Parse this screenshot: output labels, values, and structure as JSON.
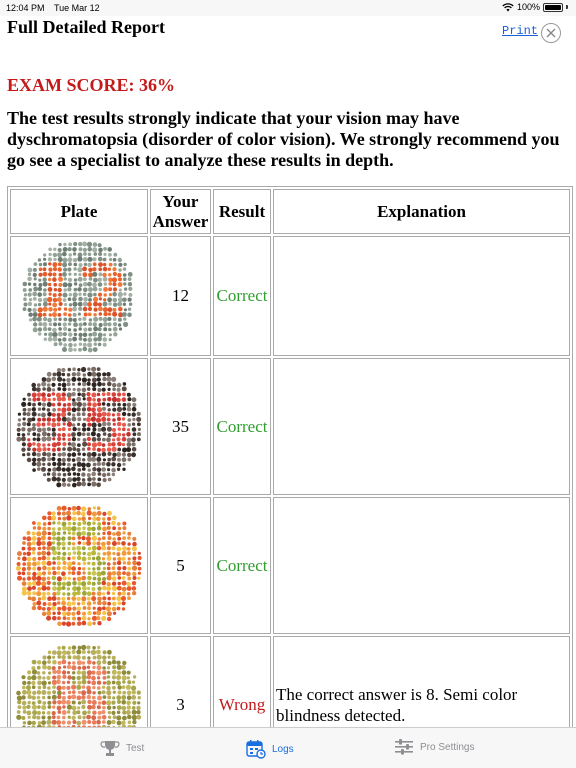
{
  "status_bar": {
    "time": "12:04 PM",
    "date": "Tue Mar 12",
    "battery": "100%"
  },
  "report": {
    "title": "Full Detailed Report",
    "print_label": "Print",
    "exam_score": "EXAM SCORE: 36%",
    "message": "The test results strongly indicate that your vision may have dyschromatopsia (disorder of color vision). We strongly recommend you go see a specialist to analyze these results in depth."
  },
  "table": {
    "headers": [
      "Plate",
      "Your Answer",
      "Result",
      "Explanation"
    ],
    "rows": [
      {
        "plate_number": "12",
        "answer": "12",
        "result": "Correct",
        "explanation": ""
      },
      {
        "plate_number": "35",
        "answer": "35",
        "result": "Correct",
        "explanation": ""
      },
      {
        "plate_number": "5",
        "answer": "5",
        "result": "Correct",
        "explanation": ""
      },
      {
        "plate_number": "8",
        "answer": "3",
        "result": "Wrong",
        "explanation": "The correct answer is 8. Semi color blindness detected."
      }
    ]
  },
  "colors": {
    "correct": "#2f9e2f",
    "wrong": "#c41a1a",
    "score": "#c41a1a",
    "tab_active": "#1a6fe0",
    "tab_inactive": "#8e8e93"
  },
  "tabs": [
    {
      "label": "Test",
      "icon": "trophy-icon",
      "active": false
    },
    {
      "label": "Logs",
      "icon": "logs-calendar-icon",
      "active": true
    },
    {
      "label": "Pro Settings",
      "icon": "sliders-icon",
      "active": false
    }
  ]
}
